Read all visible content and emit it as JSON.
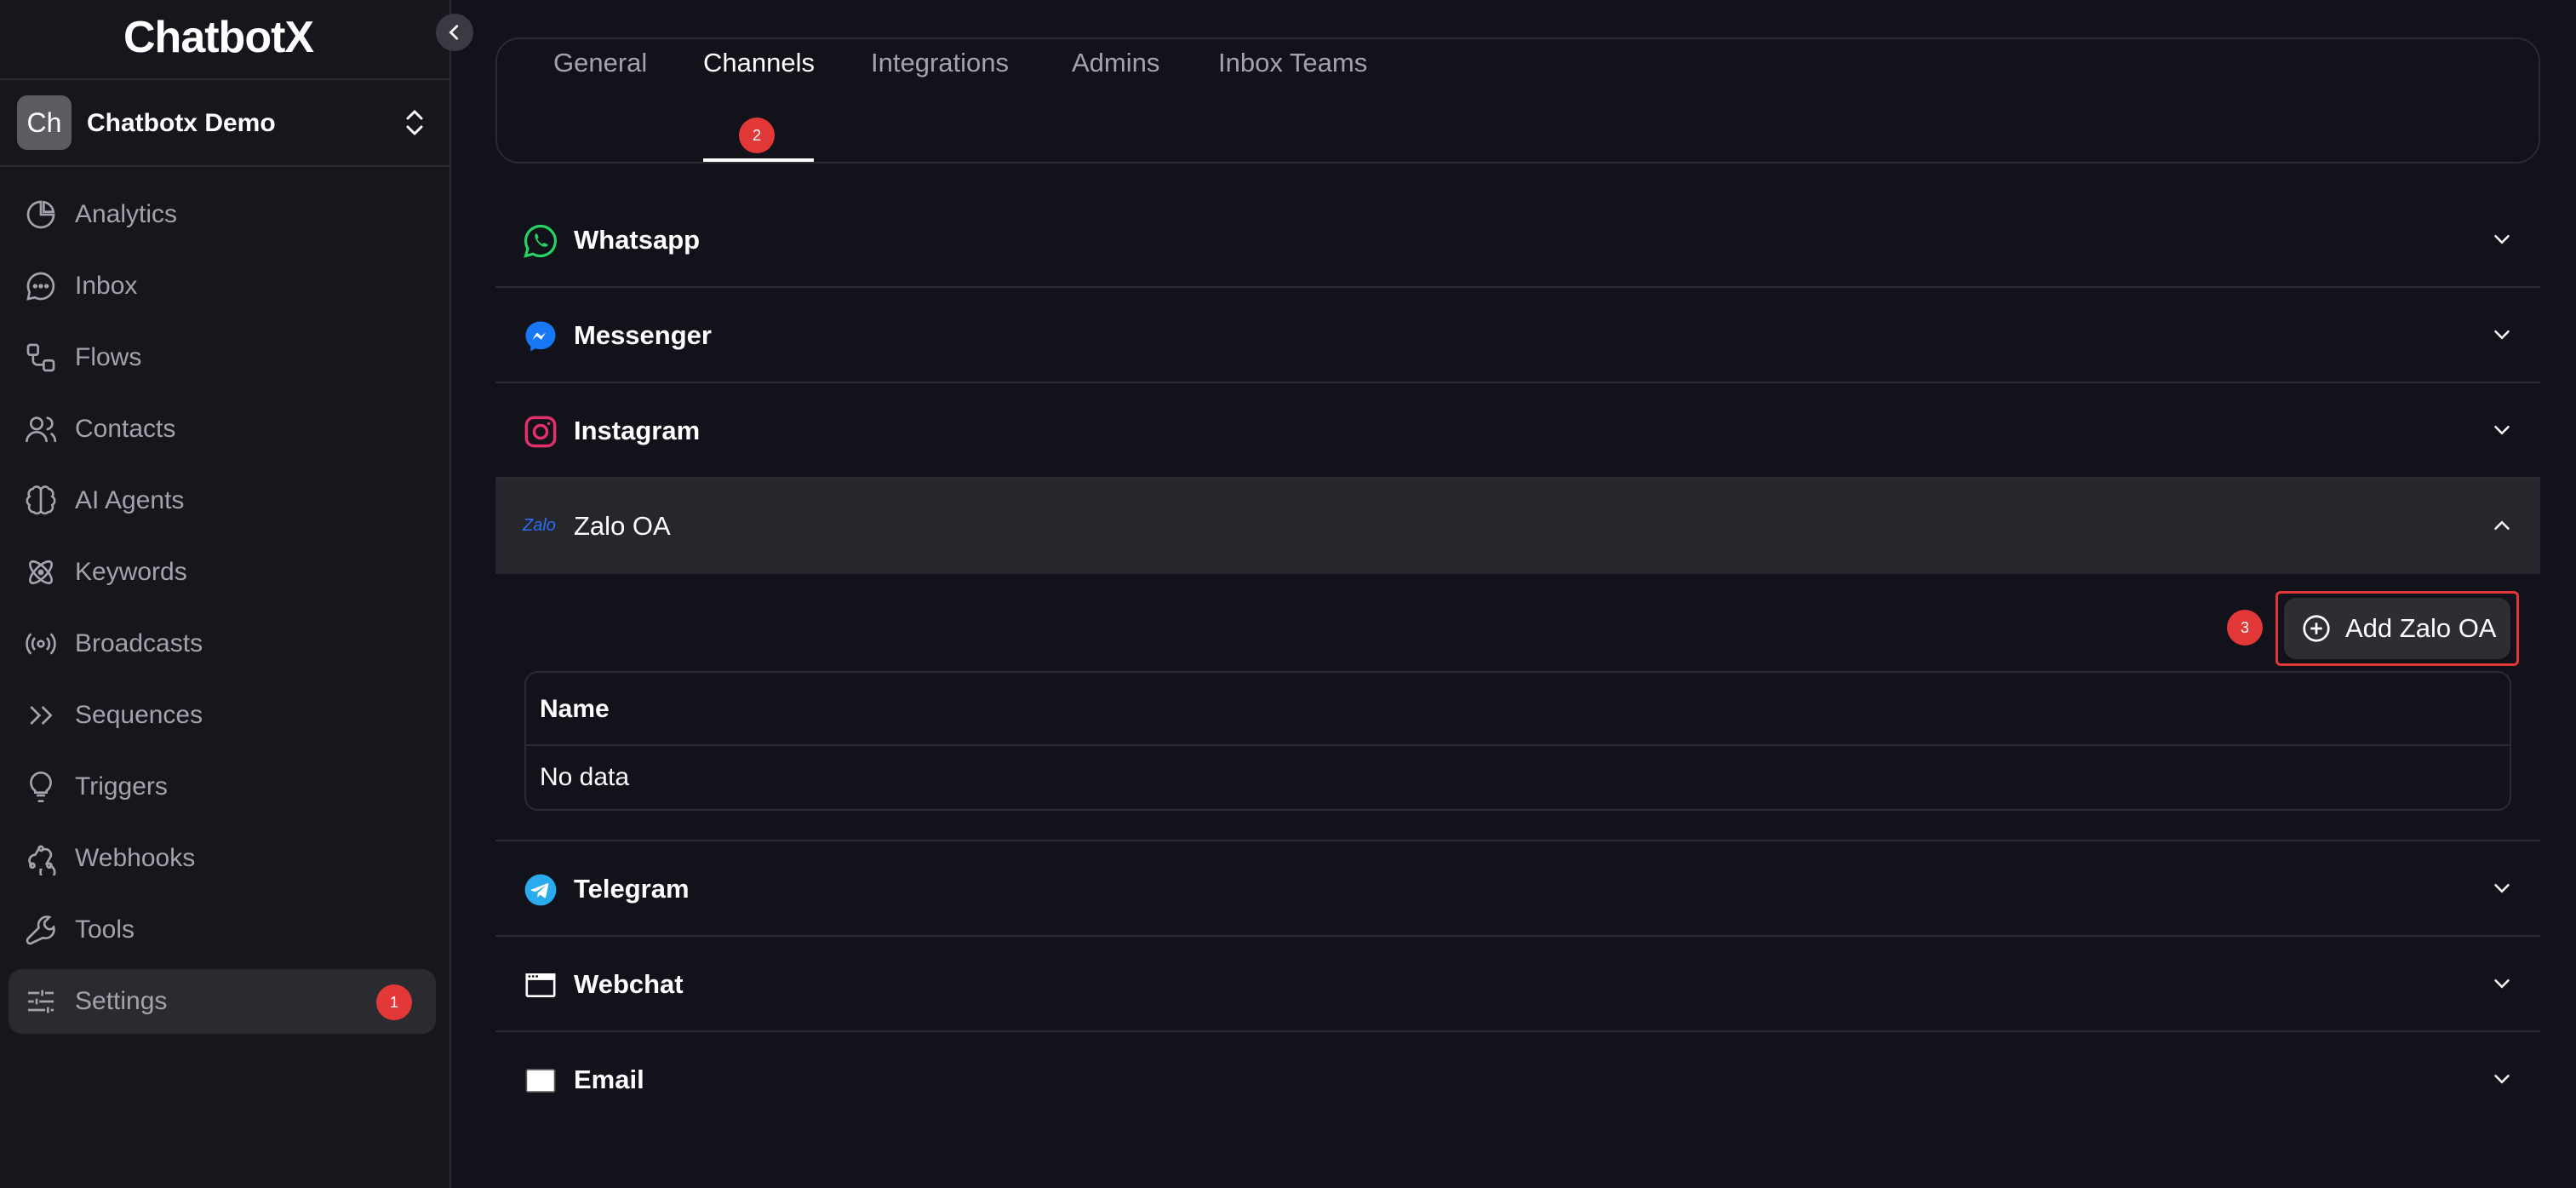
{
  "app": {
    "logo": "ChatbotX"
  },
  "workspace": {
    "avatar": "Ch",
    "name": "Chatbotx Demo"
  },
  "sidebar": {
    "items": [
      {
        "label": "Analytics",
        "icon": "pie-chart-icon"
      },
      {
        "label": "Inbox",
        "icon": "chat-bubble-icon"
      },
      {
        "label": "Flows",
        "icon": "flow-icon"
      },
      {
        "label": "Contacts",
        "icon": "users-icon"
      },
      {
        "label": "AI Agents",
        "icon": "brain-icon"
      },
      {
        "label": "Keywords",
        "icon": "atom-icon"
      },
      {
        "label": "Broadcasts",
        "icon": "broadcast-icon"
      },
      {
        "label": "Sequences",
        "icon": "double-chevron-right-icon"
      },
      {
        "label": "Triggers",
        "icon": "lightbulb-icon"
      },
      {
        "label": "Webhooks",
        "icon": "webhook-icon"
      },
      {
        "label": "Tools",
        "icon": "wrench-icon"
      },
      {
        "label": "Settings",
        "icon": "sliders-icon",
        "active": true,
        "badge": "1"
      }
    ]
  },
  "tabs": [
    {
      "label": "General"
    },
    {
      "label": "Channels",
      "active": true,
      "badge": "2"
    },
    {
      "label": "Integrations"
    },
    {
      "label": "Admins"
    },
    {
      "label": "Inbox Teams"
    }
  ],
  "channels": [
    {
      "label": "Whatsapp",
      "icon": "whatsapp-icon"
    },
    {
      "label": "Messenger",
      "icon": "messenger-icon"
    },
    {
      "label": "Instagram",
      "icon": "instagram-icon"
    },
    {
      "label": "Zalo OA",
      "icon": "zalo-icon",
      "icon_text": "Zalo",
      "open": true
    },
    {
      "label": "Telegram",
      "icon": "telegram-icon"
    },
    {
      "label": "Webchat",
      "icon": "webchat-icon"
    },
    {
      "label": "Email",
      "icon": "email-icon"
    }
  ],
  "zalo": {
    "add_button": "Add Zalo OA",
    "step_badge": "3",
    "table": {
      "columns": [
        "Name"
      ],
      "empty": "No data"
    }
  },
  "colors": {
    "accent": "#e23838",
    "background": "#11121a",
    "sidebar": "#16171d"
  }
}
